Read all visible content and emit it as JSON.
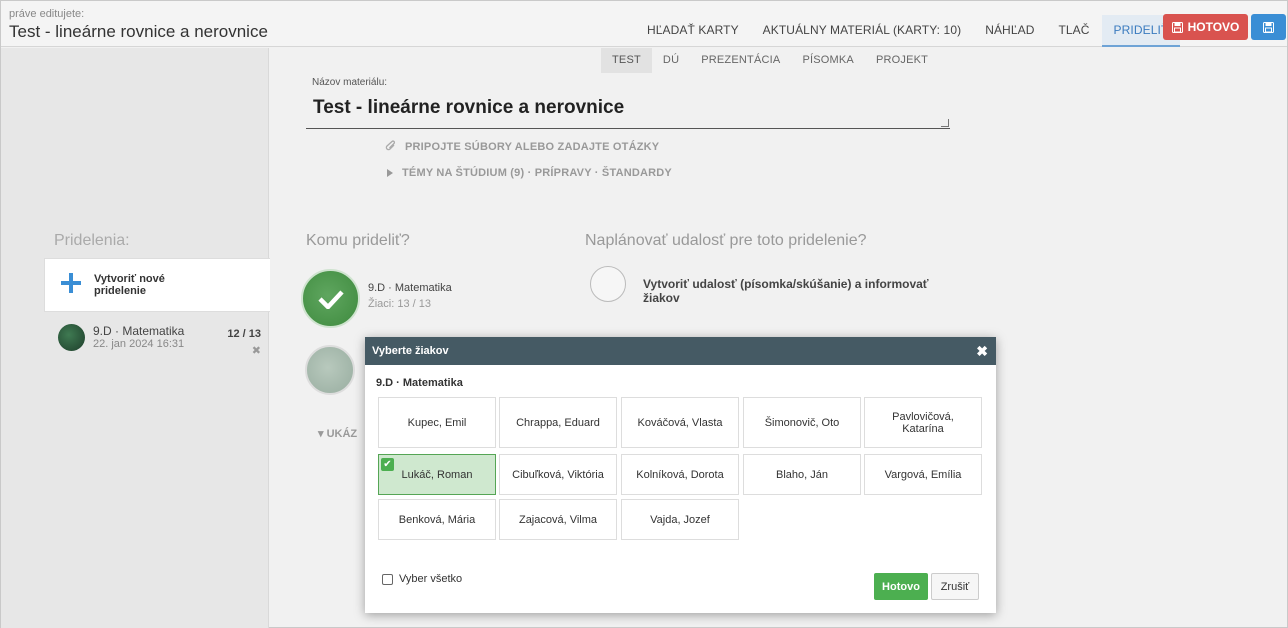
{
  "header": {
    "editing_label": "práve editujete:",
    "editing_title": "Test - lineárne rovnice a nerovnice",
    "tabs": [
      {
        "label": "HĽADAŤ KARTY",
        "active": false
      },
      {
        "label": "AKTUÁLNY MATERIÁL (KARTY: 10)",
        "active": false
      },
      {
        "label": "NÁHĽAD",
        "active": false
      },
      {
        "label": "TLAČ",
        "active": false
      },
      {
        "label": "PRIDELIŤ",
        "active": true
      }
    ],
    "done_label": "HOTOVO",
    "done_color": "#d9534f",
    "save_color": "#3a8ed5",
    "accent": "#3a7bbf"
  },
  "subnav": {
    "tabs": [
      {
        "label": "TEST",
        "active": true
      },
      {
        "label": "DÚ",
        "active": false
      },
      {
        "label": "PREZENTÁCIA",
        "active": false
      },
      {
        "label": "PÍSOMKA",
        "active": false
      },
      {
        "label": "PROJEKT",
        "active": false
      }
    ]
  },
  "material": {
    "name_label": "Názov materiálu:",
    "name_value": "Test - lineárne rovnice a nerovnice",
    "attach_label": "PRIPOJTE SÚBORY ALEBO ZADAJTE OTÁZKY",
    "topics_label": "TÉMY NA ŠTÚDIUM (9) · PRÍPRAVY · ŠTANDARDY"
  },
  "sidebar": {
    "heading": "Pridelenia:",
    "new_assignment": "Vytvoriť nové pridelenie",
    "assignments": [
      {
        "title": "9.D · Matematika",
        "date": "22. jan 2024 16:31",
        "count": "12 / 13",
        "remove": "✖"
      }
    ]
  },
  "assign": {
    "to_whom": "Komu prideliť?",
    "schedule": "Naplánovať udalosť pre toto pridelenie?",
    "class_name": "9.D · Matematika",
    "class_students": "Žiaci: 13 / 13",
    "event_text": "Vytvoriť udalosť (písomka/skúšanie) a informovať žiakov",
    "show_more": "UKÁZ"
  },
  "modal": {
    "title": "Vyberte žiakov",
    "close": "✖",
    "class_label": "9.D · Matematika",
    "students": [
      {
        "name": "Kupec, Emil",
        "selected": false
      },
      {
        "name": "Chrappa, Eduard",
        "selected": false
      },
      {
        "name": "Kováčová, Vlasta",
        "selected": false
      },
      {
        "name": "Šimonovič, Oto",
        "selected": false
      },
      {
        "name": "Pavlovičová, Katarína",
        "selected": false
      },
      {
        "name": "Lukáč, Roman",
        "selected": true
      },
      {
        "name": "Cibuľková, Viktória",
        "selected": false
      },
      {
        "name": "Kolníková, Dorota",
        "selected": false
      },
      {
        "name": "Blaho, Ján",
        "selected": false
      },
      {
        "name": "Vargová, Emília",
        "selected": false
      },
      {
        "name": "Benková, Mária",
        "selected": false
      },
      {
        "name": "Zajacová, Vilma",
        "selected": false
      },
      {
        "name": "Vajda, Jozef",
        "selected": false
      }
    ],
    "select_all": "Vyber všetko",
    "done": "Hotovo",
    "cancel": "Zrušiť"
  }
}
